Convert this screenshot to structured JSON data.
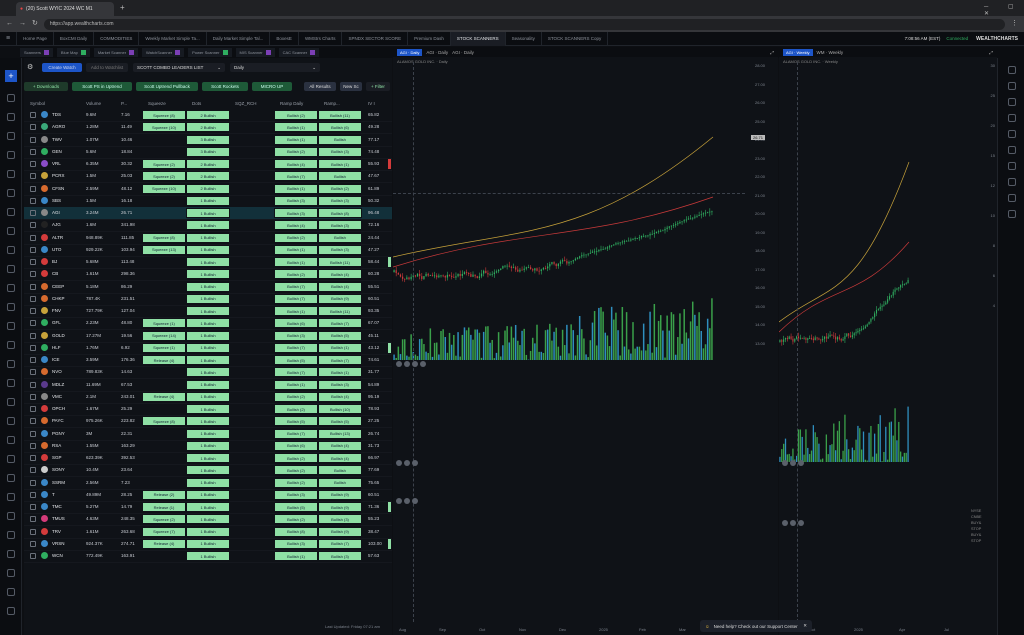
{
  "browser": {
    "tab_title": "(20) Scott WYIC 2024 WC M1",
    "url": "https://app.wealthcharts.com",
    "clock": "7:08:56 AM (EST)",
    "session_status": "Connected",
    "brand": "WEALTHCHARTS"
  },
  "app_tabs": [
    "Home Page",
    "BoxCMI Daily",
    "COMMODITIES",
    "Weekly Market Simple Ta...",
    "Daily Market Simple Tal...",
    "BoxesE",
    "WMStrs Charts",
    "SPNDX SECTOR SCORE",
    "Premium Dash",
    "STOCK SCANNERS",
    "Seasonality",
    "STOCK SCANNERS Copy"
  ],
  "active_app_tab_index": 9,
  "sub_tabs": [
    "Scanners",
    "Blue Map",
    "Market Scanner",
    "WatchScanner",
    "Power Scanner",
    "MIS Scanner",
    "CAC Scanner"
  ],
  "panel_tabs": {
    "left_chart": [
      "AGI · Daily",
      "AGI · Daily",
      "AGI · Daily"
    ],
    "right_chart": [
      "AGI · Weekly",
      "WM · Weekly"
    ]
  },
  "scanner": {
    "buttons": {
      "create_watch": "Create Watch",
      "add_to_watchlist": "Add to Watchlist",
      "list_select": "SCOTT COMBO LEADERS LIST",
      "timeframe_select": "Daily",
      "downloads": "+ Downloads",
      "filters": [
        "Scott PS in Uptrend",
        "Scott Uptrend Pullback",
        "Scott Rockets",
        "MICRO UP"
      ],
      "all_results": "All Results",
      "new_scan": "New Sc",
      "filter": "+ Filter"
    },
    "columns": [
      "Symbol",
      "Volume",
      "P...",
      "Squeeze",
      "Dots",
      "SQZ_RCH",
      "Ramp Daily",
      "Ramp...",
      "IV I"
    ],
    "rows": [
      {
        "sym": "TDS",
        "vol": "9.6M",
        "p": "7.16",
        "sq": "Squeeze (8)",
        "dots": "2 Bullish",
        "ramp1": "Bullish (2)",
        "ramp2": "Bullish (11)",
        "iv": "65.82",
        "color": "#3a87c7"
      },
      {
        "sym": "AGRO",
        "vol": "1.28M",
        "p": "11.49",
        "sq": "Squeeze (10)",
        "dots": "2 Bullish",
        "ramp1": "Bullish (1)",
        "ramp2": "Bullish (6)",
        "iv": "49.28",
        "color": "#3aa87a"
      },
      {
        "sym": "TWV",
        "vol": "1.07M",
        "p": "10.46",
        "sq": "",
        "dots": "3 Bullish",
        "ramp1": "Bullish (1)",
        "ramp2": "Bullish",
        "iv": "77.17",
        "color": "#888"
      },
      {
        "sym": "GEN",
        "vol": "5.6M",
        "p": "18.84",
        "sq": "",
        "dots": "3 Bullish",
        "ramp1": "Bullish (2)",
        "ramp2": "Bullish (3)",
        "iv": "74.48",
        "color": "#2fae60"
      },
      {
        "sym": "VRL",
        "vol": "6.35M",
        "p": "30.32",
        "sq": "Squeeze (2)",
        "dots": "2 Bullish",
        "ramp1": "Bullish (4)",
        "ramp2": "Bullish (1)",
        "iv": "55.93",
        "color": "#8a4cc7"
      },
      {
        "sym": "PCRX",
        "vol": "1.5M",
        "p": "25.03",
        "sq": "Squeeze (2)",
        "dots": "2 Bullish",
        "ramp1": "Bullish (7)",
        "ramp2": "Bullish",
        "iv": "47.67",
        "color": "#c7a23a"
      },
      {
        "sym": "CFSN",
        "vol": "2.59M",
        "p": "48.12",
        "sq": "Squeeze (10)",
        "dots": "2 Bullish",
        "ramp1": "Bullish (1)",
        "ramp2": "Bullish (2)",
        "iv": "61.89",
        "color": "#d66a2e"
      },
      {
        "sym": "SBS",
        "vol": "1.5M",
        "p": "16.18",
        "sq": "",
        "dots": "1 Bullish",
        "ramp1": "Bullish (3)",
        "ramp2": "Bullish (3)",
        "iv": "50.32",
        "color": "#3a87c7"
      },
      {
        "sym": "AGI",
        "vol": "3.24M",
        "p": "26.71",
        "sq": "",
        "dots": "1 Bullish",
        "ramp1": "Bullish (3)",
        "ramp2": "Bullish (8)",
        "iv": "96.48",
        "color": "#888"
      },
      {
        "sym": "AJG",
        "vol": "1.6M",
        "p": "341.98",
        "sq": "",
        "dots": "1 Bullish",
        "ramp1": "Bullish (4)",
        "ramp2": "Bullish (3)",
        "iv": "72.16",
        "color": "#222"
      },
      {
        "sym": "ALTR",
        "vol": "948.89K",
        "p": "111.85",
        "sq": "Squeeze (8)",
        "dots": "1 Bullish",
        "ramp1": "Bullish (2)",
        "ramp2": "Bullish",
        "iv": "24.44",
        "color": "#d43b3b"
      },
      {
        "sym": "UTO",
        "vol": "929.22K",
        "p": "103.94",
        "sq": "Squeeze (13)",
        "dots": "1 Bullish",
        "ramp1": "Bullish (1)",
        "ramp2": "Bullish (3)",
        "iv": "47.27",
        "color": "#3a87c7"
      },
      {
        "sym": "BJ",
        "vol": "5.68M",
        "p": "113.48",
        "sq": "",
        "dots": "1 Bullish",
        "ramp1": "Bullish (1)",
        "ramp2": "Bullish (11)",
        "iv": "58.44",
        "color": "#d43b3b"
      },
      {
        "sym": "CB",
        "vol": "1.61M",
        "p": "298.36",
        "sq": "",
        "dots": "1 Bullish",
        "ramp1": "Bullish (2)",
        "ramp2": "Bullish (4)",
        "iv": "60.28",
        "color": "#d43b3b"
      },
      {
        "sym": "CEEP",
        "vol": "5.18M",
        "p": "86.29",
        "sq": "",
        "dots": "1 Bullish",
        "ramp1": "Bullish (7)",
        "ramp2": "Bullish (4)",
        "iv": "55.51",
        "color": "#d66a2e"
      },
      {
        "sym": "CHKP",
        "vol": "787.4K",
        "p": "231.51",
        "sq": "",
        "dots": "1 Bullish",
        "ramp1": "Bullish (7)",
        "ramp2": "Bullish (9)",
        "iv": "60.51",
        "color": "#d66a2e"
      },
      {
        "sym": "FNV",
        "vol": "727.79K",
        "p": "127.04",
        "sq": "",
        "dots": "1 Bullish",
        "ramp1": "Bullish (1)",
        "ramp2": "Bullish (11)",
        "iv": "93.35",
        "color": "#c7a23a"
      },
      {
        "sym": "GFL",
        "vol": "2.23M",
        "p": "48.80",
        "sq": "Squeeze (1)",
        "dots": "1 Bullish",
        "ramp1": "Bullish (6)",
        "ramp2": "Bullish (7)",
        "iv": "67.07",
        "color": "#2fae60"
      },
      {
        "sym": "GOLD",
        "vol": "17.27M",
        "p": "19.56",
        "sq": "Squeeze (14)",
        "dots": "1 Bullish",
        "ramp1": "Bullish (3)",
        "ramp2": "Bullish (5)",
        "iv": "45.11",
        "color": "#c7a23a"
      },
      {
        "sym": "HLF",
        "vol": "1.76M",
        "p": "6.92",
        "sq": "Squeeze (1)",
        "dots": "1 Bullish",
        "ramp1": "Bullish (7)",
        "ramp2": "Bullish (1)",
        "iv": "43.12",
        "color": "#2fae60"
      },
      {
        "sym": "ICE",
        "vol": "3.59M",
        "p": "176.36",
        "sq": "Release (4)",
        "dots": "1 Bullish",
        "ramp1": "Bullish (5)",
        "ramp2": "Bullish (7)",
        "iv": "74.61",
        "color": "#3a87c7"
      },
      {
        "sym": "NVO",
        "vol": "789.83K",
        "p": "14.63",
        "sq": "",
        "dots": "1 Bullish",
        "ramp1": "Bullish (7)",
        "ramp2": "Bullish (1)",
        "iv": "31.77",
        "color": "#d66a2e"
      },
      {
        "sym": "MDLZ",
        "vol": "11.69M",
        "p": "67.53",
        "sq": "",
        "dots": "1 Bullish",
        "ramp1": "Bullish (1)",
        "ramp2": "Bullish (3)",
        "iv": "54.89",
        "color": "#5a3a8c"
      },
      {
        "sym": "VMC",
        "vol": "2.1M",
        "p": "243.01",
        "sq": "Release (4)",
        "dots": "1 Bullish",
        "ramp1": "Bullish (2)",
        "ramp2": "Bullish (4)",
        "iv": "95.19",
        "color": "#888"
      },
      {
        "sym": "OPCH",
        "vol": "1.67M",
        "p": "25.29",
        "sq": "",
        "dots": "1 Bullish",
        "ramp1": "Bullish (2)",
        "ramp2": "Bullish (10)",
        "iv": "78.93",
        "color": "#d43b3b"
      },
      {
        "sym": "PAYC",
        "vol": "975.26K",
        "p": "223.82",
        "sq": "Squeeze (8)",
        "dots": "1 Bullish",
        "ramp1": "Bullish (5)",
        "ramp2": "Bullish (5)",
        "iv": "27.25",
        "color": "#d66a2e"
      },
      {
        "sym": "PGNY",
        "vol": "3M",
        "p": "22.31",
        "sq": "",
        "dots": "1 Bullish",
        "ramp1": "Bullish (7)",
        "ramp2": "Bullish (13)",
        "iv": "26.74",
        "color": "#3a87c7"
      },
      {
        "sym": "RSA",
        "vol": "1.55M",
        "p": "163.29",
        "sq": "",
        "dots": "1 Bullish",
        "ramp1": "Bullish (6)",
        "ramp2": "Bullish (4)",
        "iv": "31.73",
        "color": "#d66a2e"
      },
      {
        "sym": "SGP",
        "vol": "623.39K",
        "p": "392.53",
        "sq": "",
        "dots": "1 Bullish",
        "ramp1": "Bullish (2)",
        "ramp2": "Bullish (4)",
        "iv": "66.97",
        "color": "#d43b3b"
      },
      {
        "sym": "SONY",
        "vol": "10.4M",
        "p": "23.64",
        "sq": "",
        "dots": "1 Bullish",
        "ramp1": "Bullish (2)",
        "ramp2": "Bullish",
        "iv": "77.69",
        "color": "#ccc"
      },
      {
        "sym": "SSRM",
        "vol": "2.56M",
        "p": "7.23",
        "sq": "",
        "dots": "1 Bullish",
        "ramp1": "Bullish (2)",
        "ramp2": "Bullish",
        "iv": "75.65",
        "color": "#3a87c7"
      },
      {
        "sym": "T",
        "vol": "49.89M",
        "p": "28.25",
        "sq": "Release (2)",
        "dots": "1 Bullish",
        "ramp1": "Bullish (3)",
        "ramp2": "Bullish (9)",
        "iv": "60.51",
        "color": "#3a87c7"
      },
      {
        "sym": "TMC",
        "vol": "5.27M",
        "p": "14.79",
        "sq": "Release (1)",
        "dots": "1 Bullish",
        "ramp1": "Bullish (5)",
        "ramp2": "Bullish (9)",
        "iv": "71.36",
        "color": "#3a87c7"
      },
      {
        "sym": "TMUS",
        "vol": "4.63M",
        "p": "248.35",
        "sq": "Squeeze (2)",
        "dots": "1 Bullish",
        "ramp1": "Bullish (2)",
        "ramp2": "Bullish (3)",
        "iv": "55.23",
        "color": "#d43b7a"
      },
      {
        "sym": "TRV",
        "vol": "1.61M",
        "p": "263.68",
        "sq": "Squeeze (7)",
        "dots": "1 Bullish",
        "ramp1": "Bullish (8)",
        "ramp2": "Bullish (9)",
        "iv": "38.47",
        "color": "#d43b3b"
      },
      {
        "sym": "VRSN",
        "vol": "924.37K",
        "p": "274.71",
        "sq": "Release (4)",
        "dots": "1 Bullish",
        "ramp1": "Bullish (3)",
        "ramp2": "Bullish (7)",
        "iv": "103.00",
        "color": "#3a87c7"
      },
      {
        "sym": "WCN",
        "vol": "772.49K",
        "p": "163.91",
        "sq": "",
        "dots": "1 Bullish",
        "ramp1": "Bullish (1)",
        "ramp2": "Bullish (3)",
        "iv": "57.63",
        "color": "#2fae60"
      }
    ],
    "selected_index": 8
  },
  "left_chart": {
    "symbol_line": "ALAMOS GOLD INC. · Daily",
    "x_labels": [
      "Aug",
      "Sep",
      "Oct",
      "Nov",
      "Dec",
      "2025",
      "Feb",
      "Mar",
      "Apr"
    ],
    "y_labels": [
      "28.00",
      "27.00",
      "26.00",
      "25.00",
      "24.00",
      "23.00",
      "22.00",
      "21.00",
      "20.00",
      "19.00",
      "18.00",
      "17.00",
      "16.00",
      "15.00",
      "14.00",
      "13.00"
    ],
    "price_tag": "26.71"
  },
  "right_chart": {
    "symbol_line": "ALAMOS GOLD INC. · Weekly",
    "x_labels": [
      "Oct",
      "2025",
      "Apr",
      "Jul"
    ],
    "y_labels": [
      "30",
      "25",
      "20",
      "15",
      "12",
      "10",
      "8",
      "6",
      "4"
    ],
    "side_labels": [
      "NYSE",
      "CNBE",
      "BUY&",
      "STOP",
      "BUY&",
      "STOP"
    ]
  },
  "help": {
    "text": "Need help? Check out our Support Center"
  },
  "footer": {
    "text": "Last Updated: Friday 07:21 am"
  }
}
